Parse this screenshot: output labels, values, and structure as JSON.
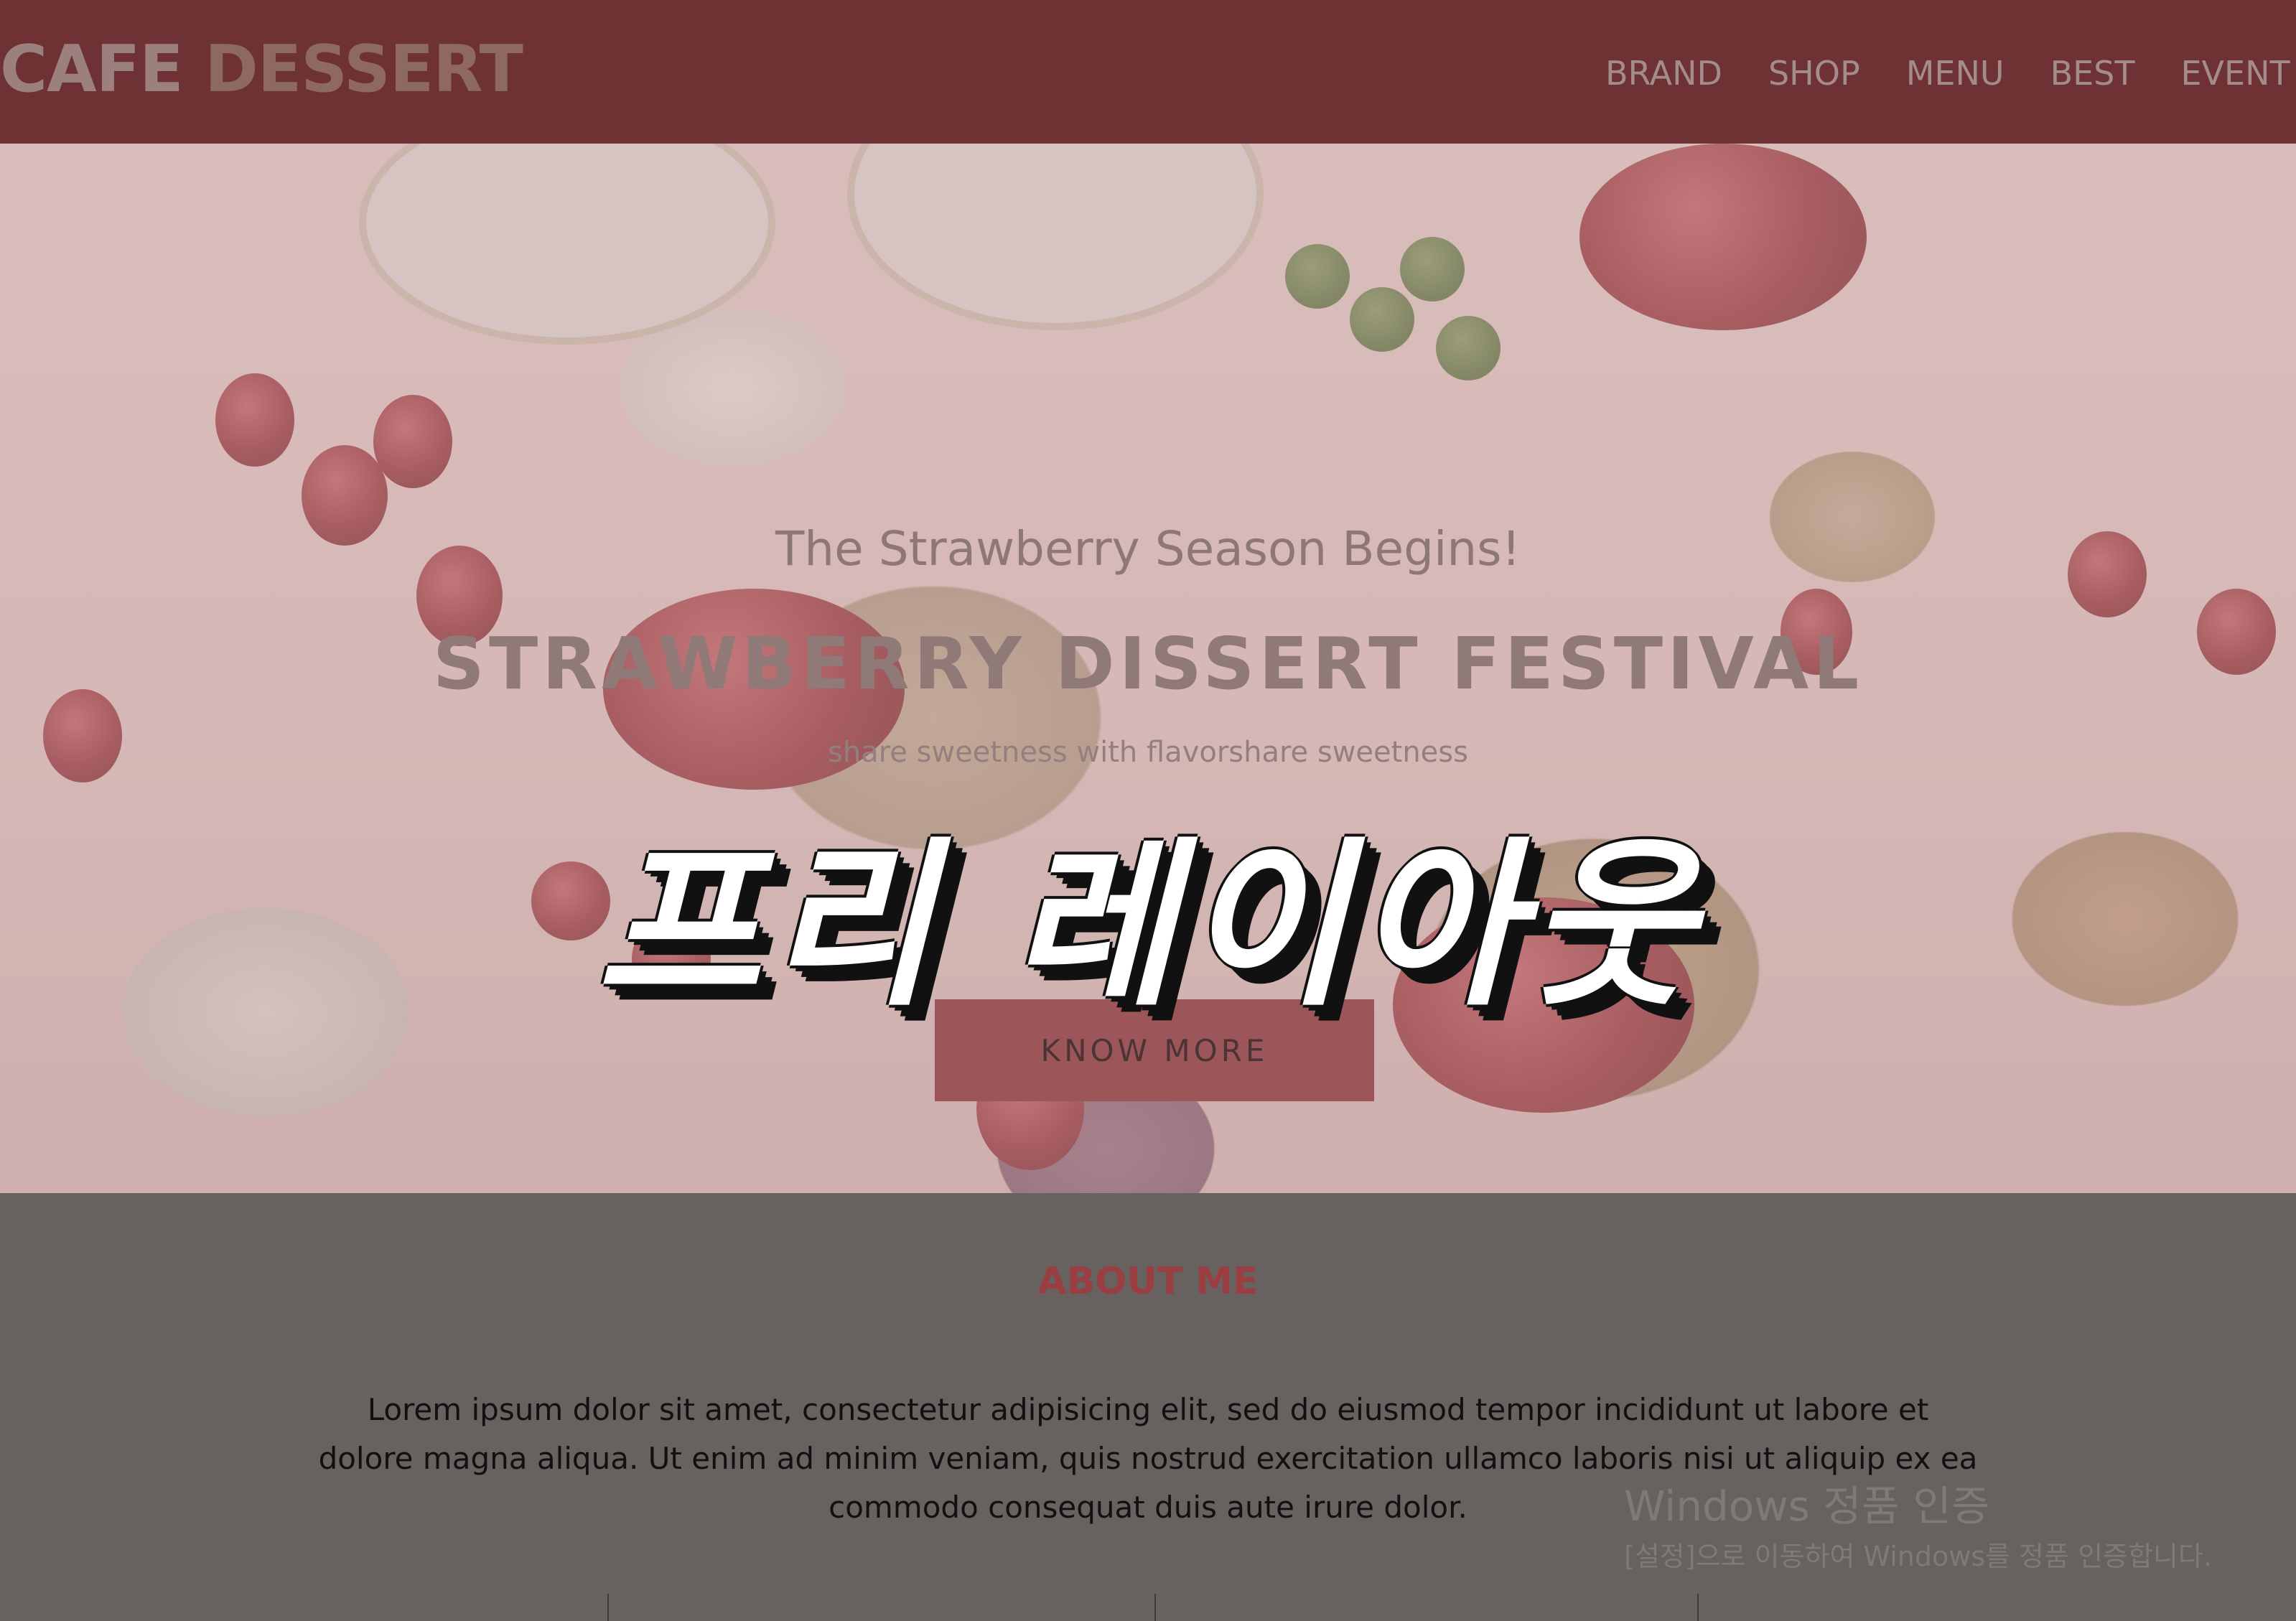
{
  "header": {
    "logo_part1": "CAFE",
    "logo_part2": "DESSERT",
    "nav": [
      "BRAND",
      "SHOP",
      "MENU",
      "BEST",
      "EVENT"
    ]
  },
  "hero": {
    "subtitle": "The Strawberry Season Begins!",
    "title": "STRAWBERRY DISSERT FESTIVAL",
    "description": "share sweetness with flavorshare sweetness",
    "button_label": "KNOW MORE",
    "overlay_text": "프리 레이아웃"
  },
  "about": {
    "title": "ABOUT ME",
    "line1": "Lorem ipsum dolor sit amet, consectetur adipisicing elit, sed do eiusmod tempor incididunt ut labore et",
    "line2": "dolore magna aliqua. Ut enim ad minim veniam, quis nostrud exercitation ullamco laboris nisi ut aliquip ex ea",
    "line3": "commodo consequat duis aute irure dolor."
  },
  "windows_activation": {
    "title": "Windows 정품 인증",
    "subtitle": "[설정]으로 이동하여 Windows를 정품 인증합니다."
  },
  "colors": {
    "header_bg": "#6e3234",
    "accent": "#9c5558",
    "about_title": "#9a3e42",
    "page_bg": "#676160"
  }
}
